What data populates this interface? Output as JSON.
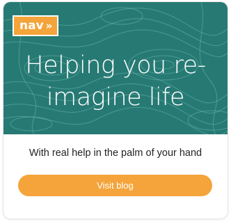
{
  "brand": {
    "logo_text": "nav",
    "logo_chevrons": "»",
    "accent_color": "#f4a43a",
    "hero_color": "#2a7d77"
  },
  "hero": {
    "headline_line1": "Helping you re-",
    "headline_line2": "imagine life"
  },
  "body": {
    "subtitle": "With real help in the palm of your hand"
  },
  "cta": {
    "label": "Visit blog"
  }
}
